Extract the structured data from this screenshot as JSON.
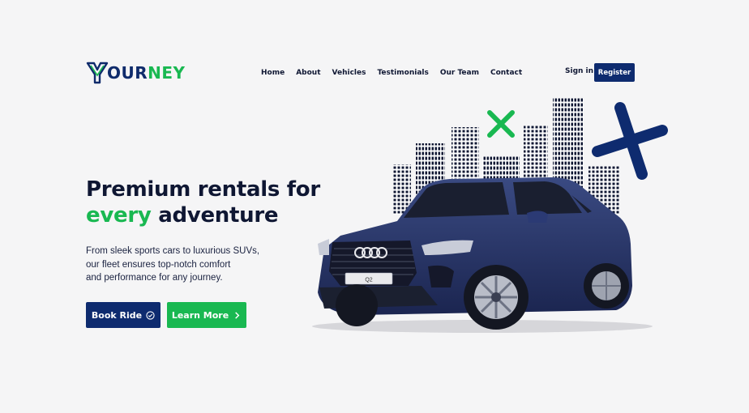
{
  "brand": {
    "logo_text_a": "OUR",
    "logo_text_b": "NEY",
    "primary_color": "#0e2b6f",
    "accent_color": "#19b851"
  },
  "nav": {
    "items": [
      {
        "label": "Home"
      },
      {
        "label": "About"
      },
      {
        "label": "Vehicles"
      },
      {
        "label": "Testimonials"
      },
      {
        "label": "Our Team"
      },
      {
        "label": "Contact"
      }
    ],
    "signin_label": "Sign in",
    "register_label": "Register"
  },
  "hero": {
    "title_line1": "Premium rentals for",
    "title_accent": "every",
    "title_rest": " adventure",
    "description_line1": "From sleek sports cars to luxurious SUVs,",
    "description_line2": "our fleet ensures top-notch comfort",
    "description_line3": "and performance for any journey.",
    "book_label": "Book Ride",
    "book_icon": "check-circle-icon",
    "learn_label": "Learn More",
    "learn_icon": "chevron-right-icon"
  },
  "illustration": {
    "plate_text": "Q2"
  }
}
